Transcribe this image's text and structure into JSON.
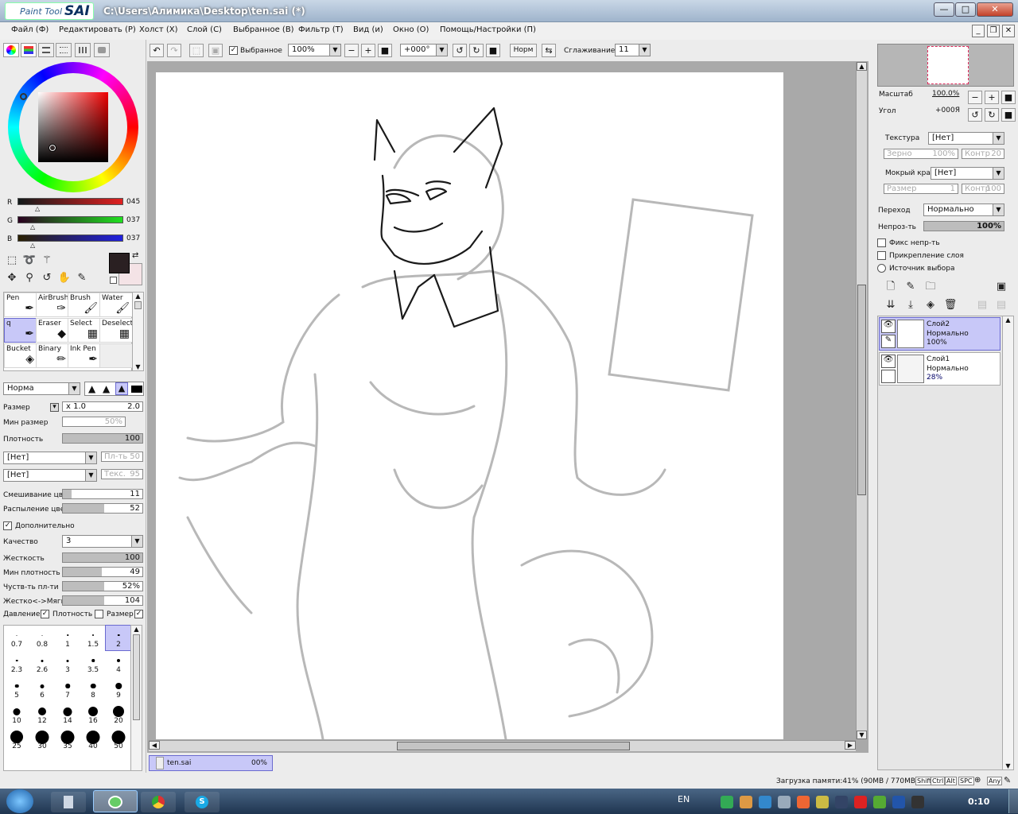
{
  "window": {
    "logo_small": "Paint Tool",
    "logo_big": "SAI",
    "title": "C:\\Users\\Алимика\\Desktop\\ten.sai (*)",
    "btn_min": "—",
    "btn_max": "□",
    "btn_close": "✕"
  },
  "menu": {
    "items": [
      "Файл (Ф)",
      "Редактировать (Р)",
      "Холст (Х)",
      "Слой (С)",
      "Выбранное (В)",
      "Фильтр (Т)",
      "Вид (и)",
      "Окно (О)",
      "Помощь/Настройки (П)"
    ]
  },
  "toolbar": {
    "selected_label": "Выбранное",
    "zoom_value": "100%",
    "angle_value": "+000°",
    "blend_label": "Норм",
    "smooth_label": "Сглаживание",
    "smooth_value": "11"
  },
  "color": {
    "current": "#2A2022",
    "secondary": "#F4E3E6",
    "r_label": "R",
    "r_value": "045",
    "g_label": "G",
    "g_value": "037",
    "b_label": "B",
    "b_value": "037"
  },
  "brushes": {
    "cells": [
      "Pen",
      "AirBrush",
      "Brush",
      "Water",
      "q",
      "Eraser",
      "Select",
      "Deselect",
      "Bucket",
      "Binary",
      "Ink Pen",
      ""
    ]
  },
  "brushsettings": {
    "shape_value": "Норма",
    "size_label": "Размер",
    "size_mult": "x 1.0",
    "size_value": "2.0",
    "minsize_label": "Мин размер",
    "minsize_value": "50%",
    "density_label": "Плотность",
    "density_value": "100",
    "tex1_value": "[Нет]",
    "tex1_side_label": "Пл-ть",
    "tex1_side_value": "50",
    "tex2_value": "[Нет]",
    "tex2_side_label": "Текс.",
    "tex2_side_value": "95",
    "blend_label": "Смешивание цвет",
    "blend_value": "11",
    "dilution_label": "Распыление цвет",
    "dilution_value": "52",
    "advanced_label": "Дополнительно",
    "quality_label": "Качество",
    "quality_value": "3",
    "hardness_label": "Жесткость",
    "hardness_value": "100",
    "mindensity_label": "Мин плотность",
    "mindensity_value": "49",
    "sensitivity_label": "Чуств-ть пл-ти",
    "sensitivity_value": "52%",
    "softness_label": "Жестко<->Мягко",
    "softness_value": "104",
    "pressure_label": "Давление:",
    "pressure_density_label": "Плотность",
    "pressure_size_label": "Размер"
  },
  "sizes": [
    "0.7",
    "0.8",
    "1",
    "1.5",
    "2",
    "2.3",
    "2.6",
    "3",
    "3.5",
    "4",
    "5",
    "6",
    "7",
    "8",
    "9",
    "10",
    "12",
    "14",
    "16",
    "20",
    "25",
    "30",
    "35",
    "40",
    "50"
  ],
  "navigator": {
    "scale_label": "Масштаб",
    "scale_value": "100.0%",
    "angle_label": "Угол",
    "angle_value": "+000Я"
  },
  "layerprops": {
    "texture_label": "Текстура",
    "texture_value": "[Нет]",
    "grain_label": "Зерно",
    "grain_value": "100%",
    "contrast_label": "Контр",
    "contrast_value": "20",
    "wetedge_label": "Мокрый край",
    "wetedge_value": "[Нет]",
    "wsize_label": "Размер",
    "wsize_value": "1",
    "wcontrast_label": "Контр",
    "wcontrast_value": "100",
    "mode_label": "Переход",
    "mode_value": "Нормально",
    "opacity_label": "Непроз-ть",
    "opacity_value": "100%",
    "fix_label": "Фикс непр-ть",
    "clip_label": "Прикрепление слоя",
    "source_label": "Источник выбора"
  },
  "layers": [
    {
      "name": "Слой2",
      "mode": "Нормально",
      "opacity": "100%"
    },
    {
      "name": "Слой1",
      "mode": "Нормально",
      "opacity": "28%"
    }
  ],
  "doc_tab": {
    "name": "ten.sai",
    "progress": "00%"
  },
  "status": {
    "memory": "Загрузка памяти:41% (90MB / 770MB)",
    "keys": [
      "Shift",
      "Ctrl",
      "Alt",
      "SPC",
      "Any"
    ]
  },
  "taskbar": {
    "lang": "EN",
    "clock": "0:10"
  }
}
